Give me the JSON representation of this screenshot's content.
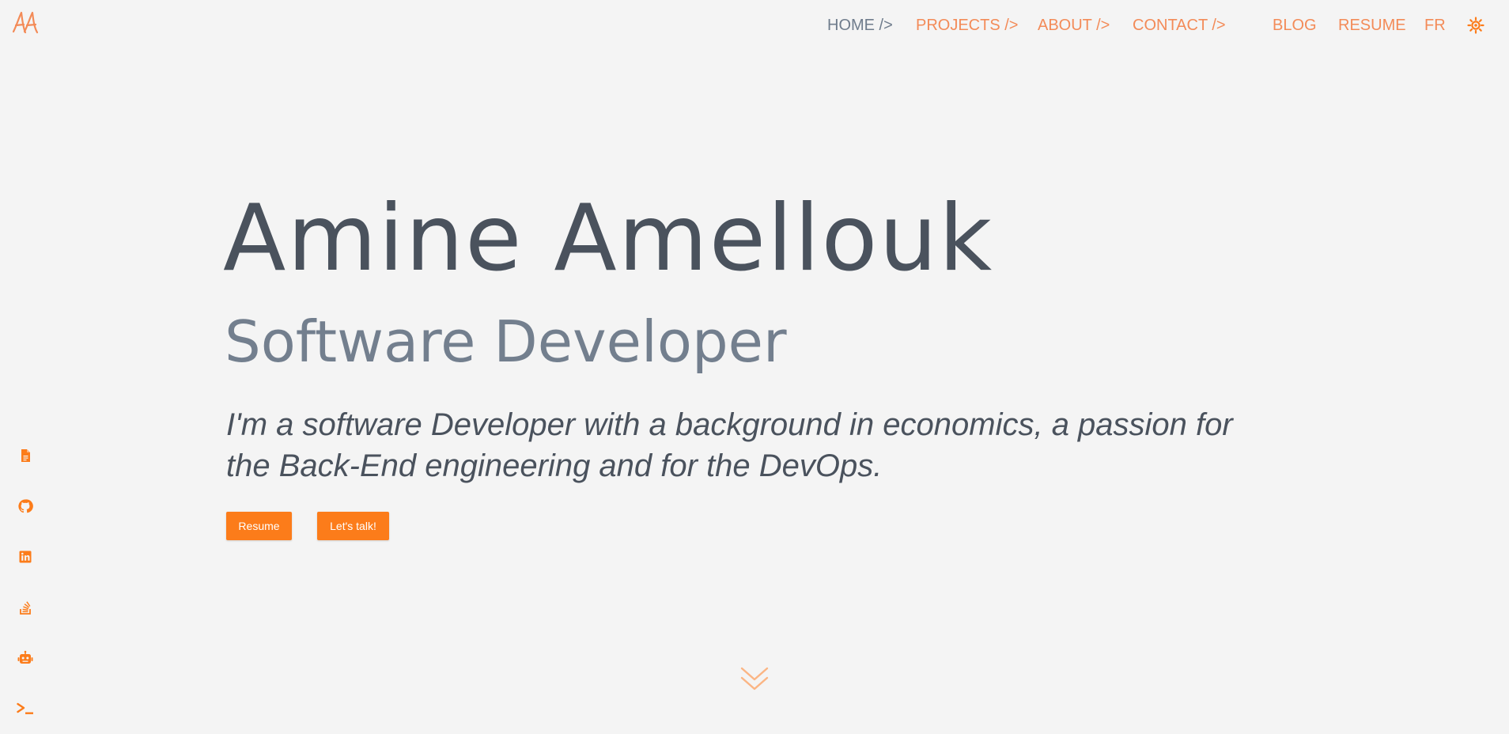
{
  "logo": {
    "text": "AA",
    "color": "#f38b58"
  },
  "nav": {
    "items": [
      {
        "label": "HOME />",
        "active": true
      },
      {
        "label": "PROJECTS />",
        "active": false
      },
      {
        "label": "ABOUT />",
        "active": false
      },
      {
        "label": "CONTACT />",
        "active": false
      },
      {
        "label": "BLOG",
        "active": false
      },
      {
        "label": "RESUME",
        "active": false
      },
      {
        "label": "FR",
        "active": false
      }
    ],
    "theme_toggle_icon": "sun-icon"
  },
  "hero": {
    "name": "Amine Amellouk",
    "role": "Software Developer",
    "description": "I'm a software Developer with a background in economics, a passion for the Back-End engineering and for the DevOps.",
    "buttons": {
      "resume": "Resume",
      "talk": "Let's talk!"
    }
  },
  "social": [
    {
      "icon": "document-icon"
    },
    {
      "icon": "github-icon"
    },
    {
      "icon": "linkedin-icon"
    },
    {
      "icon": "stackoverflow-icon"
    },
    {
      "icon": "robot-icon"
    },
    {
      "icon": "terminal-icon"
    }
  ],
  "scroll_icon": "chevron-double-down-icon",
  "colors": {
    "accent": "#fc7c1a",
    "nav_link": "#f38b58",
    "nav_active": "#6f7c8c",
    "heading": "#4a525d",
    "subheading": "#737f8e",
    "background": "#f4f4f4"
  }
}
